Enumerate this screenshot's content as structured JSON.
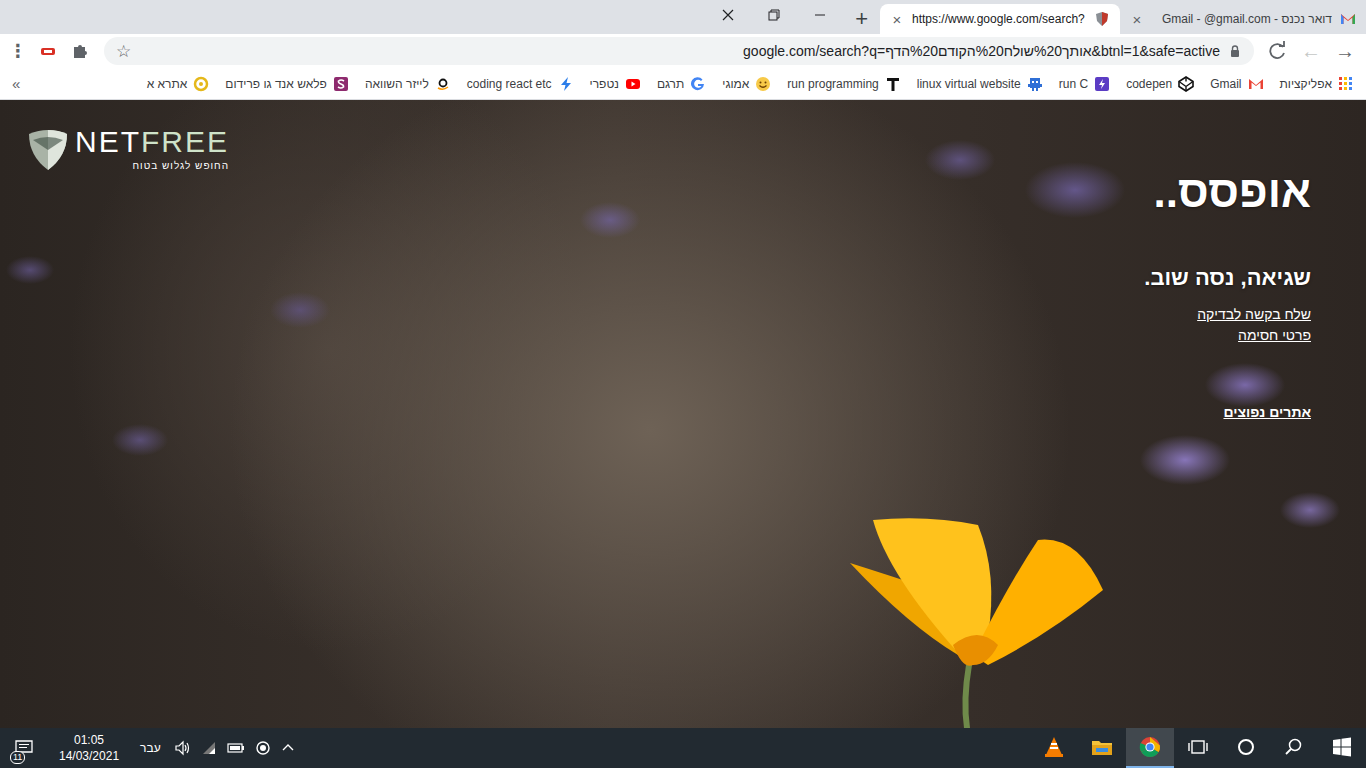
{
  "tabs": [
    {
      "label": "דואר נכנס - Gmail - @gmail.com",
      "selected": false,
      "kind": "gmail"
    },
    {
      "label": "https://www.google.com/search?",
      "selected": true,
      "kind": "netfree"
    }
  ],
  "tab_close": "×",
  "new_tab": "+",
  "toolbar": {
    "back": {
      "symbol": "→",
      "disabled": false
    },
    "forward": {
      "symbol": "←",
      "disabled": true
    },
    "url": "google.com/search?q=אותך%20שולח%20הקודם%20הדף&btnl=1&safe=active",
    "star": "☆",
    "menu": "⋮"
  },
  "bookmarks": [
    {
      "label": "אפליקציות",
      "kind": "apps"
    },
    {
      "label": "Gmail",
      "kind": "gmail"
    },
    {
      "label": "codepen",
      "kind": "codepen"
    },
    {
      "label": "run C",
      "kind": "bolt-purple"
    },
    {
      "label": "linux virtual website",
      "kind": "pixel"
    },
    {
      "label": "run programming",
      "kind": "letter-t"
    },
    {
      "label": "אמוגי",
      "kind": "smiley"
    },
    {
      "label": "תרגם",
      "kind": "google"
    },
    {
      "label": "נטפרי",
      "kind": "youtube"
    },
    {
      "label": "coding react etc",
      "kind": "bolt-blue"
    },
    {
      "label": "לייזר השוואה",
      "kind": "amazon"
    },
    {
      "label": "פלאש אנד גו פרידום",
      "kind": "s-purple"
    },
    {
      "label": "אתרא א",
      "kind": "ring"
    }
  ],
  "bookmarks_overflow": "»",
  "page": {
    "logo": {
      "name_start": "NET",
      "name_end": "FREE",
      "tagline": "החופש לגלוש בטוח"
    },
    "heading": "אופסס..",
    "message": "שגיאה, נסה שוב.",
    "links": [
      "שלח בקשה לבדיקה",
      "פרטי חסימה"
    ],
    "popular": "אתרים נפוצים"
  },
  "taskbar": {
    "apps": [
      {
        "kind": "start",
        "selected": false
      },
      {
        "kind": "search",
        "selected": false
      },
      {
        "kind": "cortana",
        "selected": false
      },
      {
        "kind": "taskview",
        "selected": false
      },
      {
        "kind": "chrome",
        "selected": true
      },
      {
        "kind": "explorer",
        "selected": false
      },
      {
        "kind": "vlc",
        "selected": false
      }
    ],
    "language": "עבר",
    "time": "01:05",
    "date": "14/03/2021",
    "notifications": "11"
  }
}
